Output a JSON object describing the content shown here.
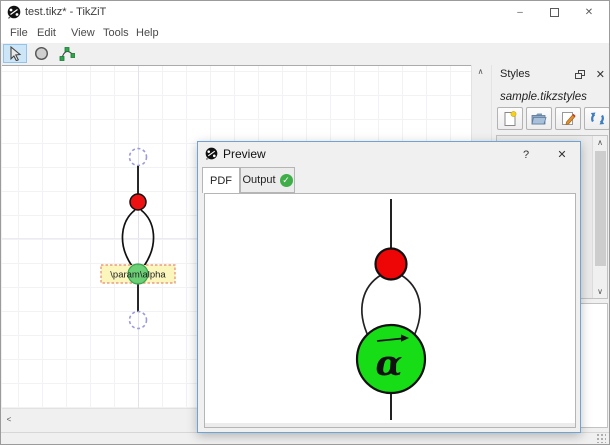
{
  "window": {
    "title": "test.tikz* - TikZiT",
    "minimize_glyph": "–",
    "close_glyph": "✕"
  },
  "menu": {
    "items": [
      "File",
      "Edit",
      "View",
      "Tools",
      "Help"
    ]
  },
  "toolbar": {
    "tools": [
      "select-tool",
      "node-tool",
      "edge-tool"
    ],
    "selected": "select-tool"
  },
  "canvas": {
    "selected_label": "\\param\\alpha"
  },
  "scroll": {
    "up_glyph": "∧",
    "down_glyph": "∨",
    "left_glyph": "<"
  },
  "styles_panel": {
    "title": "Styles",
    "filename": "sample.tikzstyles",
    "close_glyph": "✕",
    "buttons": [
      "new-style-file",
      "open-style-file",
      "edit-styles",
      "refresh-styles"
    ]
  },
  "preview": {
    "title": "Preview",
    "help_glyph": "?",
    "close_glyph": "✕",
    "tabs": {
      "pdf": "PDF",
      "output": "Output"
    },
    "output_check_glyph": "✓",
    "figure": {
      "alpha_glyph": "α"
    }
  },
  "colors": {
    "node_red": "#ee1111",
    "node_green_preview": "#17dd17",
    "node_green_editor": "#52c96a",
    "label_fill": "#fbf6bb",
    "label_border": "#e88a6a",
    "ghost_node": "#9a9ade",
    "selected_tool_bg": "#cde6f7",
    "dialog_border": "#6fa3d4",
    "check_green": "#3fae49"
  }
}
